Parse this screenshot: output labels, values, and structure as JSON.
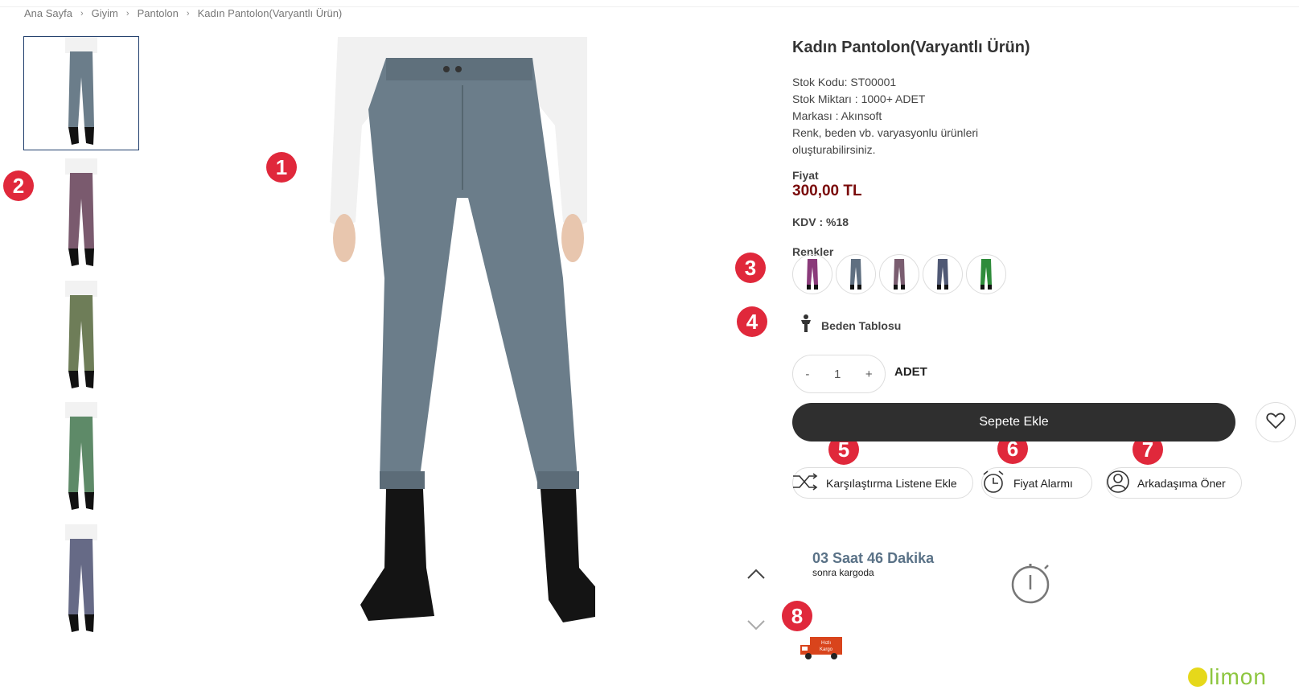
{
  "breadcrumb": [
    "Ana Sayfa",
    "Giyim",
    "Pantolon",
    "Kadın Pantolon(Varyantlı Ürün)"
  ],
  "product": {
    "title": "Kadın Pantolon(Varyantlı Ürün)",
    "stock_code": "Stok Kodu: ST00001",
    "stock_qty": "Stok Miktarı : 1000+ ADET",
    "brand": "Markası : Akınsoft",
    "description": "Renk, beden vb. varyasyonlu ürünleri oluşturabilirsiniz.",
    "price_label": "Fiyat",
    "price": "300,00 TL",
    "kdv": "KDV : %18",
    "colors_label": "Renkler",
    "size_table": "Beden Tablosu"
  },
  "thumbnails": [
    {
      "color": "#6b7d8a",
      "selected": true
    },
    {
      "color": "#7a5a6e",
      "selected": false
    },
    {
      "color": "#6e7d58",
      "selected": false
    },
    {
      "color": "#5e8a68",
      "selected": false
    },
    {
      "color": "#666a86",
      "selected": false
    }
  ],
  "swatches": [
    "#8a3a7a",
    "#5f6f80",
    "#7a5d70",
    "#4f5874",
    "#2e8b3a"
  ],
  "quantity": {
    "minus": "-",
    "value": "1",
    "plus": "+",
    "unit": "ADET"
  },
  "add_to_cart": "Sepete Ekle",
  "actions": {
    "compare": "Karşılaştırma Listene Ekle",
    "price_alarm": "Fiyat Alarmı",
    "recommend": "Arkadaşıma Öner"
  },
  "shipping": {
    "time": "03 Saat 46 Dakika",
    "sub": "sonra kargoda"
  },
  "fast_shipping": {
    "line1": "Hızlı",
    "line2": "Kargo"
  },
  "badges": [
    "1",
    "2",
    "3",
    "4",
    "5",
    "6",
    "7",
    "8"
  ],
  "nav": {
    "up": "up",
    "down": "down"
  },
  "main_image_color": "#6b7d8a",
  "logo": "limon"
}
